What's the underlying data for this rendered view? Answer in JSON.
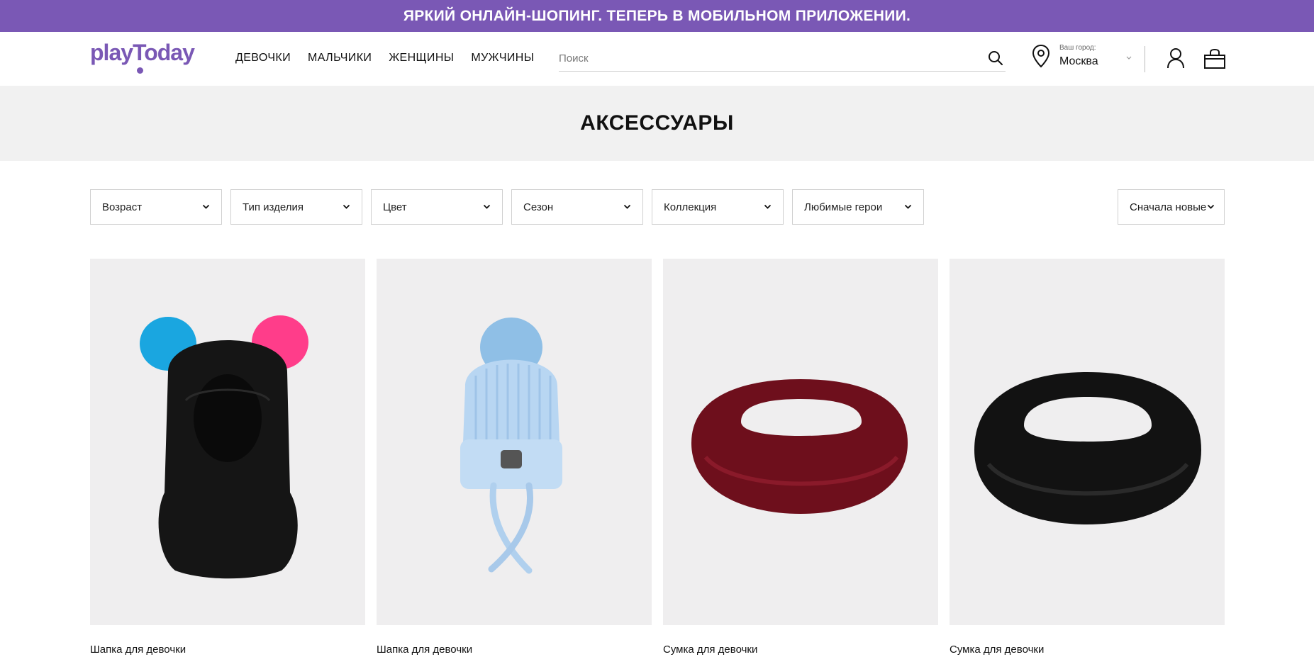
{
  "promo": {
    "text": "ЯРКИЙ ОНЛАЙН-ШОПИНГ. ТЕПЕРЬ В МОБИЛЬНОМ ПРИЛОЖЕНИИ."
  },
  "header": {
    "logo": "playToday",
    "nav": [
      "ДЕВОЧКИ",
      "МАЛЬЧИКИ",
      "ЖЕНЩИНЫ",
      "МУЖЧИНЫ"
    ],
    "search": {
      "placeholder": "Поиск",
      "value": ""
    },
    "city": {
      "label": "Ваш город:",
      "value": "Москва"
    }
  },
  "page": {
    "title": "АКСЕССУАРЫ"
  },
  "filters": [
    "Возраст",
    "Тип изделия",
    "Цвет",
    "Сезон",
    "Коллекция",
    "Любимые герои"
  ],
  "sort": {
    "selected": "Сначала новые"
  },
  "products": [
    {
      "name": "Шапка для девочки",
      "image": "black-balaclava-with-pompoms"
    },
    {
      "name": "Шапка для девочки",
      "image": "light-blue-knit-hat-with-pompom"
    },
    {
      "name": "Сумка для девочки",
      "image": "burgundy-fur-bag"
    },
    {
      "name": "Сумка для девочки",
      "image": "black-fur-bag"
    }
  ],
  "colors": {
    "brand": "#7a58b5",
    "hero_bg": "#f1f1f1",
    "card_bg": "#efeeef"
  }
}
